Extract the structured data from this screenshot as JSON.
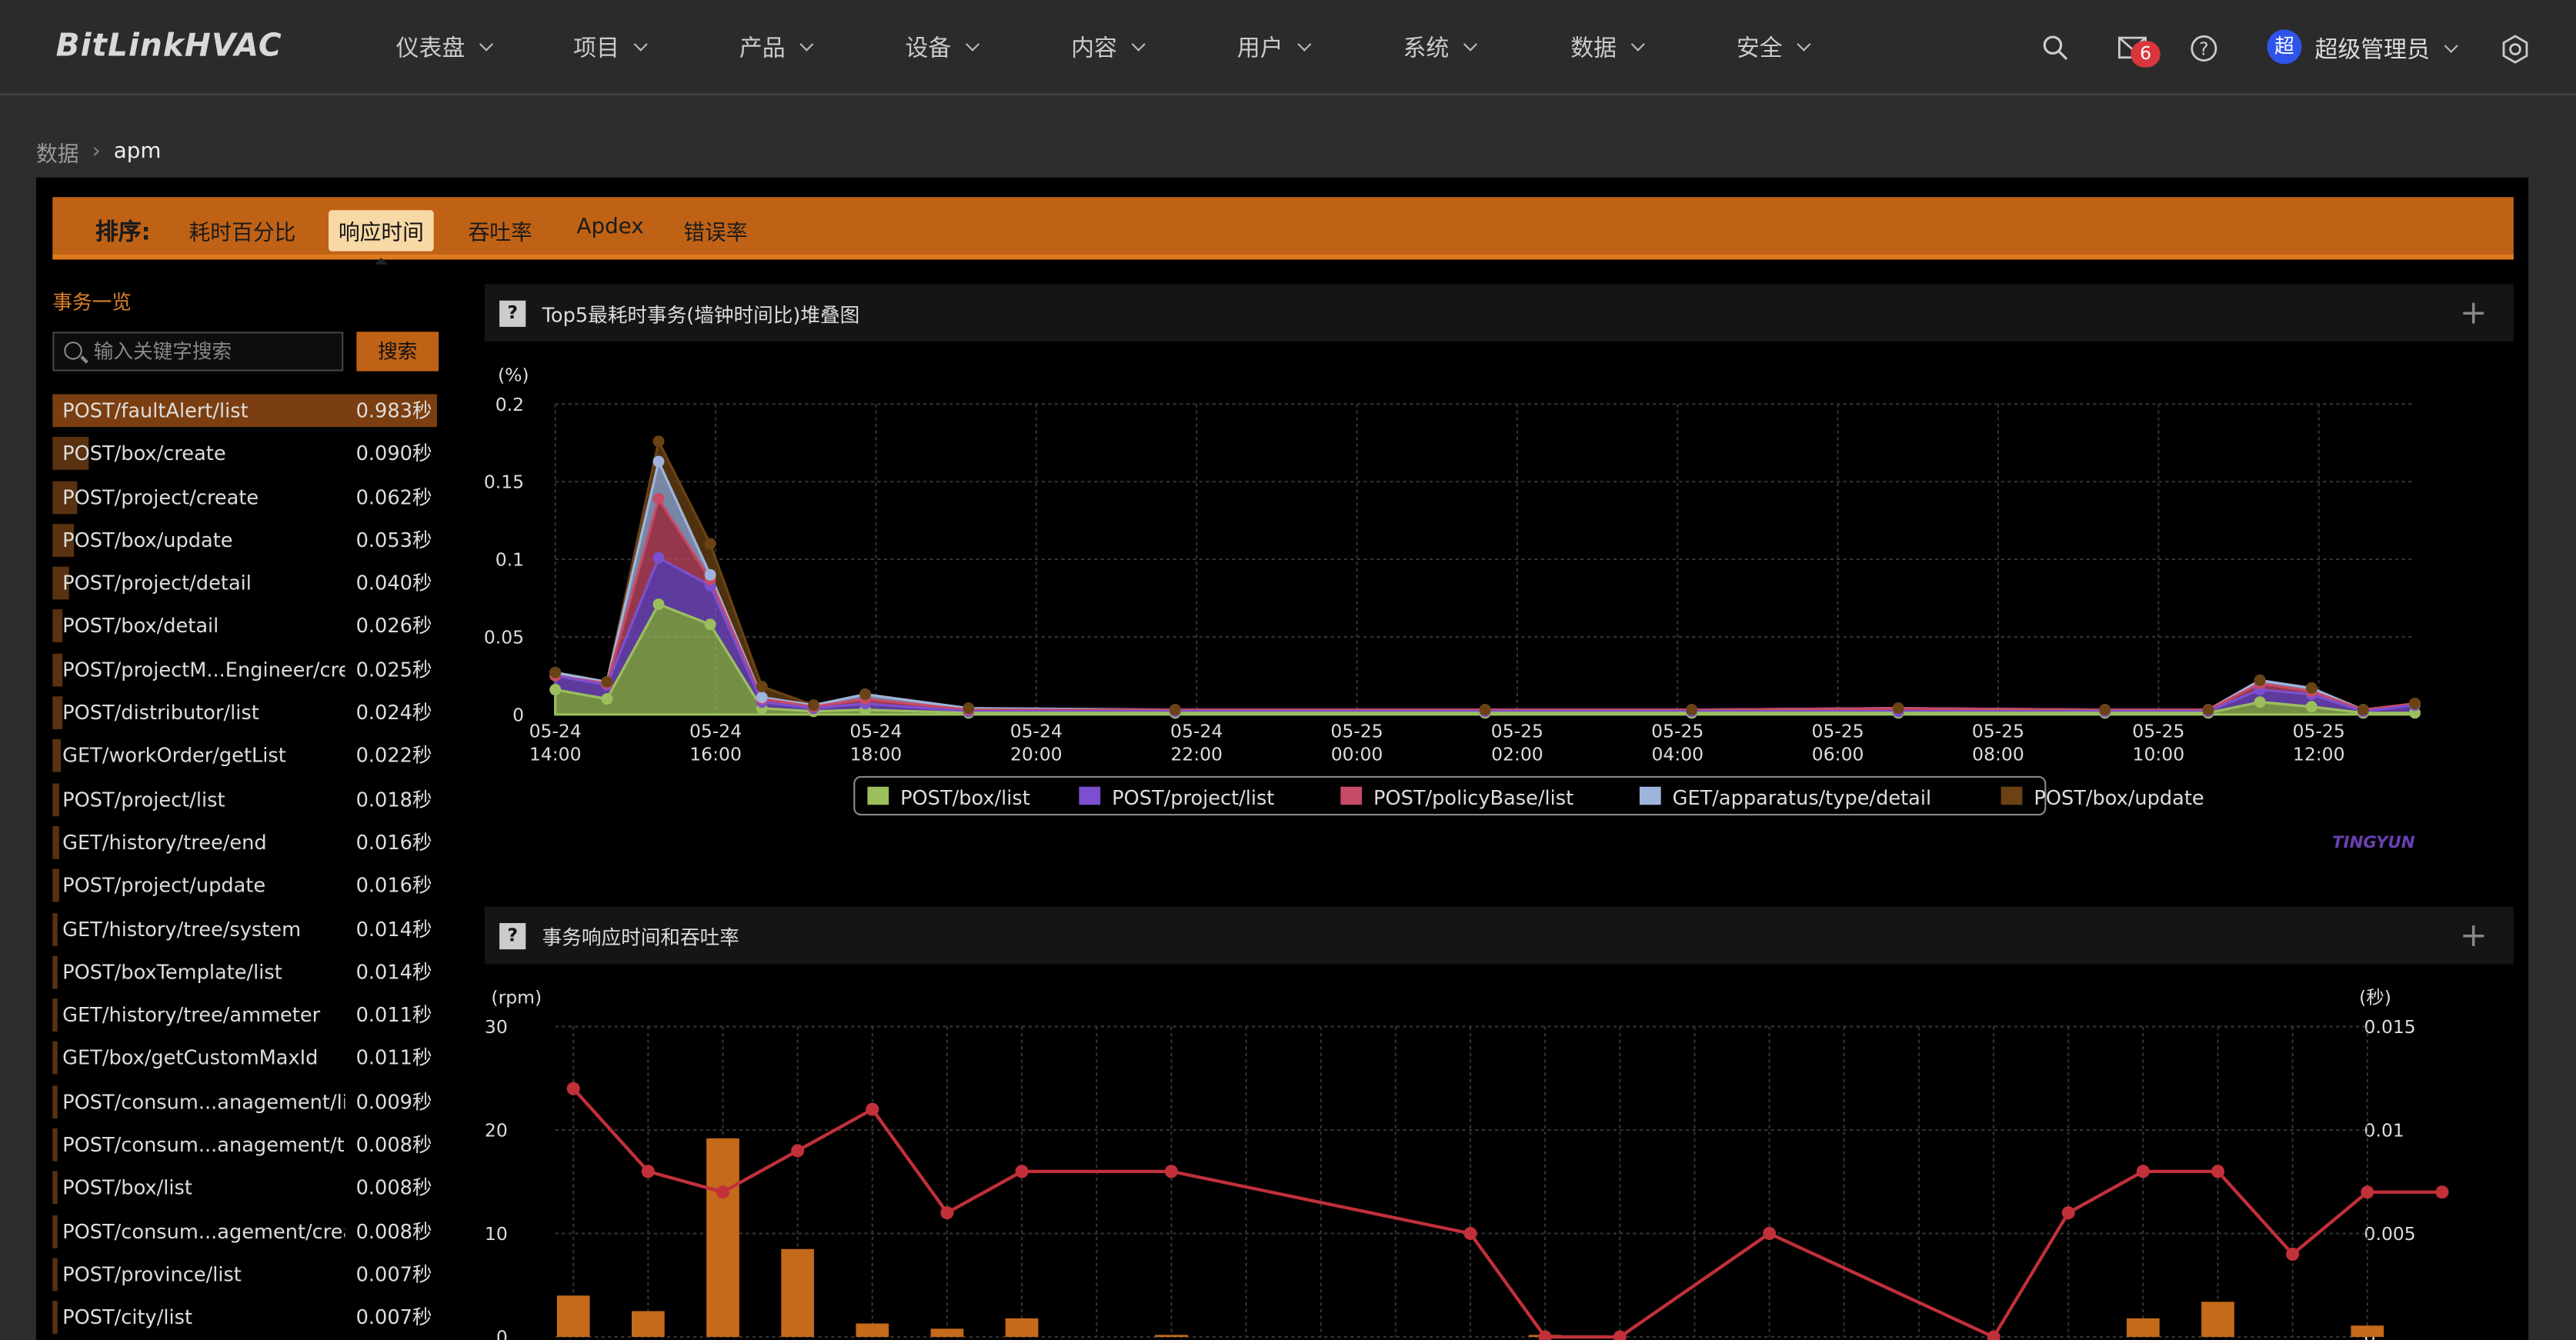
{
  "app": {
    "logo": "BitLinkHVAC"
  },
  "nav": [
    "仪表盘",
    "项目",
    "产品",
    "设备",
    "内容",
    "用户",
    "系统",
    "数据",
    "安全"
  ],
  "header": {
    "mail_count": "6",
    "avatar_char": "超",
    "user": "超级管理员"
  },
  "breadcrumb": {
    "parent": "数据",
    "current": "apm"
  },
  "sortbar": {
    "label": "排序:",
    "options": [
      "耗时百分比",
      "响应时间",
      "吞吐率",
      "Apdex",
      "错误率"
    ],
    "active": "响应时间"
  },
  "sidebar": {
    "title": "事务一览",
    "search_placeholder": "输入关键字搜索",
    "search_button": "搜索",
    "items": [
      {
        "name": "POST/faultAlert/list",
        "value": "0.983秒",
        "ratio": 1.0
      },
      {
        "name": "POST/box/create",
        "value": "0.090秒",
        "ratio": 0.092
      },
      {
        "name": "POST/project/create",
        "value": "0.062秒",
        "ratio": 0.063
      },
      {
        "name": "POST/box/update",
        "value": "0.053秒",
        "ratio": 0.054
      },
      {
        "name": "POST/project/detail",
        "value": "0.040秒",
        "ratio": 0.041
      },
      {
        "name": "POST/box/detail",
        "value": "0.026秒",
        "ratio": 0.026
      },
      {
        "name": "POST/projectM...Engineer/create",
        "value": "0.025秒",
        "ratio": 0.025
      },
      {
        "name": "POST/distributor/list",
        "value": "0.024秒",
        "ratio": 0.024
      },
      {
        "name": "GET/workOrder/getList",
        "value": "0.022秒",
        "ratio": 0.022
      },
      {
        "name": "POST/project/list",
        "value": "0.018秒",
        "ratio": 0.018
      },
      {
        "name": "GET/history/tree/end",
        "value": "0.016秒",
        "ratio": 0.016
      },
      {
        "name": "POST/project/update",
        "value": "0.016秒",
        "ratio": 0.016
      },
      {
        "name": "GET/history/tree/system",
        "value": "0.014秒",
        "ratio": 0.014
      },
      {
        "name": "POST/boxTemplate/list",
        "value": "0.014秒",
        "ratio": 0.014
      },
      {
        "name": "GET/history/tree/ammeter",
        "value": "0.011秒",
        "ratio": 0.011
      },
      {
        "name": "GET/box/getCustomMaxId",
        "value": "0.011秒",
        "ratio": 0.011
      },
      {
        "name": "POST/consum...anagement/list",
        "value": "0.009秒",
        "ratio": 0.009
      },
      {
        "name": "POST/consum...anagement/tree",
        "value": "0.008秒",
        "ratio": 0.008
      },
      {
        "name": "POST/box/list",
        "value": "0.008秒",
        "ratio": 0.008
      },
      {
        "name": "POST/consum...agement/create",
        "value": "0.008秒",
        "ratio": 0.008
      },
      {
        "name": "POST/province/list",
        "value": "0.007秒",
        "ratio": 0.007
      },
      {
        "name": "POST/city/list",
        "value": "0.007秒",
        "ratio": 0.007
      }
    ]
  },
  "cards": {
    "top5_title": "Top5最耗时事务(墙钟时间比)堆叠图",
    "resp_title": "事务响应时间和吞吐率",
    "watermark": "TINGYUN"
  },
  "chart_data": [
    {
      "type": "area",
      "title": "Top5最耗时事务(墙钟时间比)堆叠图",
      "ylabel": "(%)",
      "ylim": [
        0,
        0.2
      ],
      "yticks": [
        "0",
        "0.05",
        "0.1",
        "0.15",
        "0.2"
      ],
      "xticks": [
        [
          "05-24",
          "14:00"
        ],
        [
          "05-24",
          "16:00"
        ],
        [
          "05-24",
          "18:00"
        ],
        [
          "05-24",
          "20:00"
        ],
        [
          "05-24",
          "22:00"
        ],
        [
          "05-25",
          "00:00"
        ],
        [
          "05-25",
          "02:00"
        ],
        [
          "05-25",
          "04:00"
        ],
        [
          "05-25",
          "06:00"
        ],
        [
          "05-25",
          "08:00"
        ],
        [
          "05-25",
          "10:00"
        ],
        [
          "05-25",
          "12:00"
        ]
      ],
      "x_hours": [
        0,
        1,
        2,
        3,
        4,
        5,
        6,
        8,
        12,
        18,
        22,
        26,
        30,
        32,
        33,
        34,
        35,
        36
      ],
      "series": [
        {
          "name": "POST/box/list",
          "color": "#9bbf5c",
          "values": [
            0.016,
            0.01,
            0.071,
            0.058,
            0.004,
            0.002,
            0.003,
            0.001,
            0.001,
            0.001,
            0.001,
            0.001,
            0.001,
            0.001,
            0.008,
            0.005,
            0.001,
            0.001
          ]
        },
        {
          "name": "POST/project/list",
          "color": "#7b4fd0",
          "values": [
            0.009,
            0.009,
            0.03,
            0.025,
            0.004,
            0.002,
            0.004,
            0.001,
            0.001,
            0.001,
            0.001,
            0.001,
            0.001,
            0.001,
            0.008,
            0.008,
            0.001,
            0.005
          ]
        },
        {
          "name": "POST/policyBase/list",
          "color": "#c74a66",
          "values": [
            0.0,
            0.001,
            0.038,
            0.004,
            0.002,
            0.001,
            0.003,
            0.001,
            0.001,
            0.001,
            0.001,
            0.002,
            0.001,
            0.001,
            0.004,
            0.002,
            0.001,
            0.001
          ]
        },
        {
          "name": "GET/apparatus/type/detail",
          "color": "#9fb4dc",
          "values": [
            0.002,
            0.001,
            0.024,
            0.003,
            0.001,
            0.001,
            0.003,
            0.001,
            0.0,
            0.0,
            0.0,
            0.0,
            0.0,
            0.0,
            0.002,
            0.002,
            0.0,
            0.0
          ]
        },
        {
          "name": "POST/box/update",
          "color": "#6b4214",
          "values": [
            0.0,
            0.0,
            0.013,
            0.02,
            0.007,
            0.0,
            0.0,
            0.0,
            0.0,
            0.0,
            0.0,
            0.0,
            0.0,
            0.0,
            0.0,
            0.0,
            0.0,
            0.0
          ]
        }
      ]
    },
    {
      "type": "bar+line",
      "title": "事务响应时间和吞吐率",
      "ylabel_left": "(rpm)",
      "ylabel_right": "(秒)",
      "ylim_left": [
        0,
        30
      ],
      "ylim_right": [
        0,
        0.015
      ],
      "yticks_left": [
        "0",
        "10",
        "20",
        "30"
      ],
      "yticks_right": [
        "0",
        "0.005",
        "0.01",
        "0.015"
      ],
      "x": [
        0,
        1,
        2,
        3,
        4,
        5,
        6,
        8,
        12,
        13,
        14,
        16,
        19,
        20,
        21,
        22,
        23,
        24,
        25
      ],
      "bars_rpm": [
        4,
        2.5,
        19.2,
        8.5,
        1.3,
        0.8,
        1.8,
        0.2,
        0,
        0.2,
        0,
        0,
        0,
        0,
        1.8,
        3.4,
        0,
        1.1,
        0
      ],
      "line_sec": [
        0.012,
        0.008,
        0.007,
        0.009,
        0.011,
        0.006,
        0.008,
        0.008,
        0.005,
        0,
        0,
        0.005,
        0,
        0.006,
        0.008,
        0.008,
        0.004,
        0.007,
        0.007
      ],
      "bar_color": "#c46a1a",
      "line_color": "#c2303a"
    }
  ]
}
